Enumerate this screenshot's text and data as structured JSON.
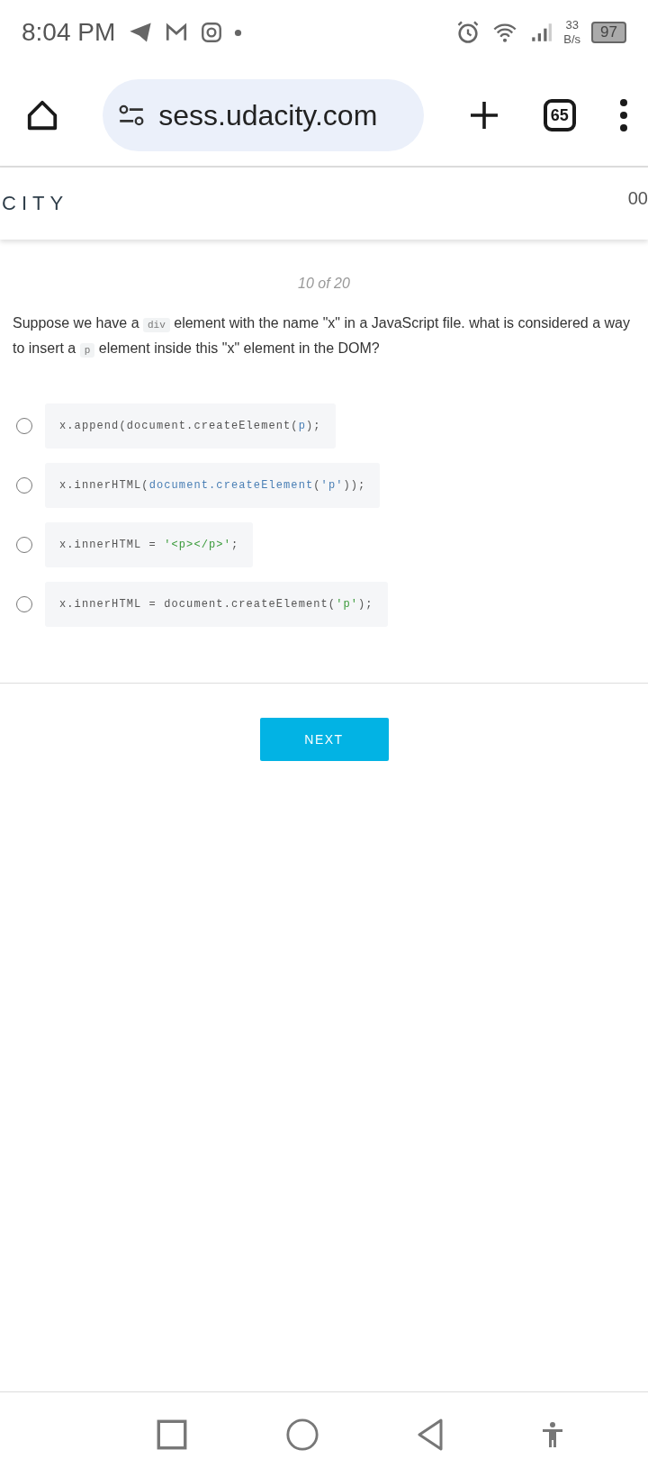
{
  "status_bar": {
    "time": "8:04 PM",
    "net_speed": "33",
    "net_unit": "B/s",
    "battery": "97"
  },
  "browser": {
    "url": "sess.udacity.com",
    "tab_count": "65"
  },
  "site_header": {
    "logo": "CITY",
    "right_text": "00"
  },
  "quiz": {
    "progress": "10 of 20",
    "question": [
      {
        "kind": "text",
        "text": "Suppose we have a "
      },
      {
        "kind": "code",
        "text": "div"
      },
      {
        "kind": "text",
        "text": " element with the name \"x\" in a JavaScript file. what is considered a way to insert a "
      },
      {
        "kind": "code",
        "text": "p"
      },
      {
        "kind": "text",
        "text": " element inside this \"x\" element in the DOM?"
      }
    ],
    "options": [
      {
        "selected": false,
        "tokens": [
          {
            "text": "x.append(document.createElement(",
            "kind": "plain"
          },
          {
            "text": "p",
            "kind": "name"
          },
          {
            "text": ");",
            "kind": "plain"
          }
        ]
      },
      {
        "selected": false,
        "tokens": [
          {
            "text": "x.innerHTML(",
            "kind": "plain"
          },
          {
            "text": "document.createElement",
            "kind": "name"
          },
          {
            "text": "(",
            "kind": "plain"
          },
          {
            "text": "'p'",
            "kind": "name"
          },
          {
            "text": "));",
            "kind": "plain"
          }
        ]
      },
      {
        "selected": false,
        "tokens": [
          {
            "text": "x.innerHTML = ",
            "kind": "plain"
          },
          {
            "text": "'<p></p>'",
            "kind": "string"
          },
          {
            "text": ";",
            "kind": "plain"
          }
        ]
      },
      {
        "selected": false,
        "tokens": [
          {
            "text": "x.innerHTML = document.createElement(",
            "kind": "plain"
          },
          {
            "text": "'p'",
            "kind": "string"
          },
          {
            "text": ");",
            "kind": "plain"
          }
        ]
      }
    ],
    "next_button": "NEXT"
  }
}
